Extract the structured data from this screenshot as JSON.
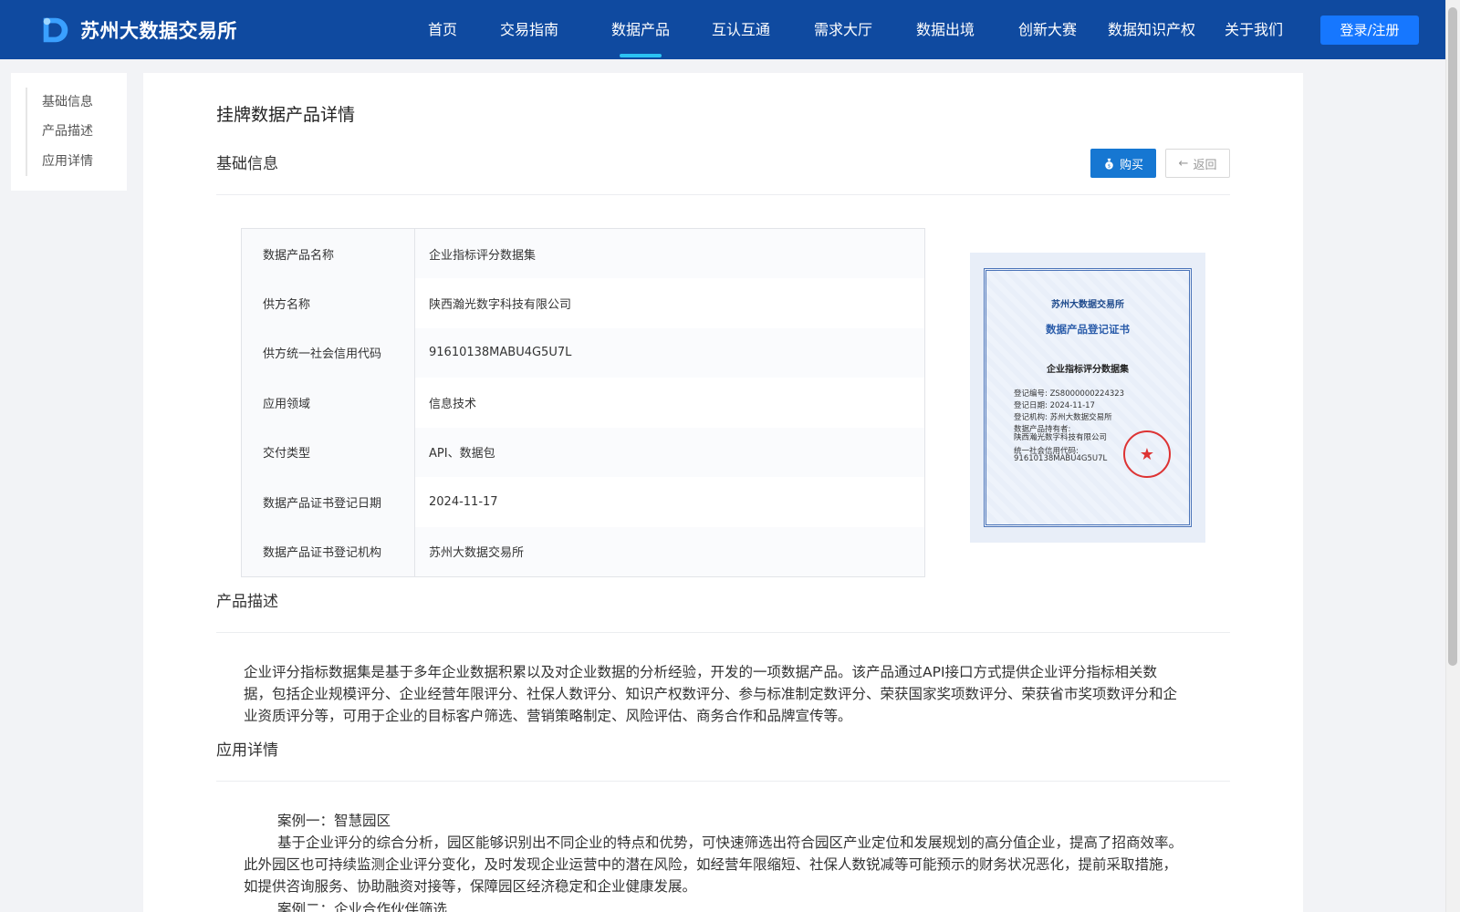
{
  "header": {
    "logo_text": "苏州大数据交易所",
    "nav": [
      "首页",
      "交易指南",
      "数据产品",
      "互认互通",
      "需求大厅",
      "数据出境",
      "创新大赛",
      "数据知识产权",
      "关于我们"
    ],
    "active_nav": "数据产品",
    "login_label": "登录/注册",
    "brand_color": "#0f4aa0",
    "accent_color": "#1677ff"
  },
  "sidebar": {
    "links": [
      "基础信息",
      "产品描述",
      "应用详情"
    ]
  },
  "page": {
    "title": "挂牌数据产品详情",
    "section_basic": "基础信息",
    "buy_label": "购买",
    "back_label": "返回",
    "buy_icon": "money-bag-icon",
    "back_icon": "arrow-left-icon"
  },
  "info": [
    {
      "key": "数据产品名称",
      "value": "企业指标评分数据集"
    },
    {
      "key": "供方名称",
      "value": "陕西瀚光数字科技有限公司"
    },
    {
      "key": "供方统一社会信用代码",
      "value": "91610138MABU4G5U7L"
    },
    {
      "key": "应用领域",
      "value": "信息技术"
    },
    {
      "key": "交付类型",
      "value": "API、数据包"
    },
    {
      "key": "数据产品证书登记日期",
      "value": "2024-11-17"
    },
    {
      "key": "数据产品证书登记机构",
      "value": "苏州大数据交易所"
    }
  ],
  "certificate": {
    "org": "苏州大数据交易所",
    "title": "数据产品登记证书",
    "product": "企业指标评分数据集",
    "lines": [
      "登记编号: ZS8000000224323",
      "登记日期: 2024-11-17",
      "登记机构: 苏州大数据交易所",
      "数据产品持有者:",
      "陕西瀚光数字科技有限公司",
      "统一社会信用代码:",
      "91610138MABU4G5U7L"
    ]
  },
  "description": {
    "title": "产品描述",
    "text": "企业评分指标数据集是基于多年企业数据积累以及对企业数据的分析经验，开发的一项数据产品。该产品通过API接口方式提供企业评分指标相关数据，包括企业规模评分、企业经营年限评分、社保人数评分、知识产权数评分、参与标准制定数评分、荣获国家奖项数评分、荣获省市奖项数评分和企业资质评分等，可用于企业的目标客户筛选、营销策略制定、风险评估、商务合作和品牌宣传等。"
  },
  "application": {
    "title": "应用详情",
    "case1_title": "案例一：智慧园区",
    "case1_text": "基于企业评分的综合分析，园区能够识别出不同企业的特点和优势，可快速筛选出符合园区产业定位和发展规划的高分值企业，提高了招商效率。此外园区也可持续监测企业评分变化，及时发现企业运营中的潜在风险，如经营年限缩短、社保人数锐减等可能预示的财务状况恶化，提前采取措施，如提供咨询服务、协助融资对接等，保障园区经济稳定和企业健康发展。",
    "case2_title": "案例二：企业合作伙伴筛选"
  }
}
